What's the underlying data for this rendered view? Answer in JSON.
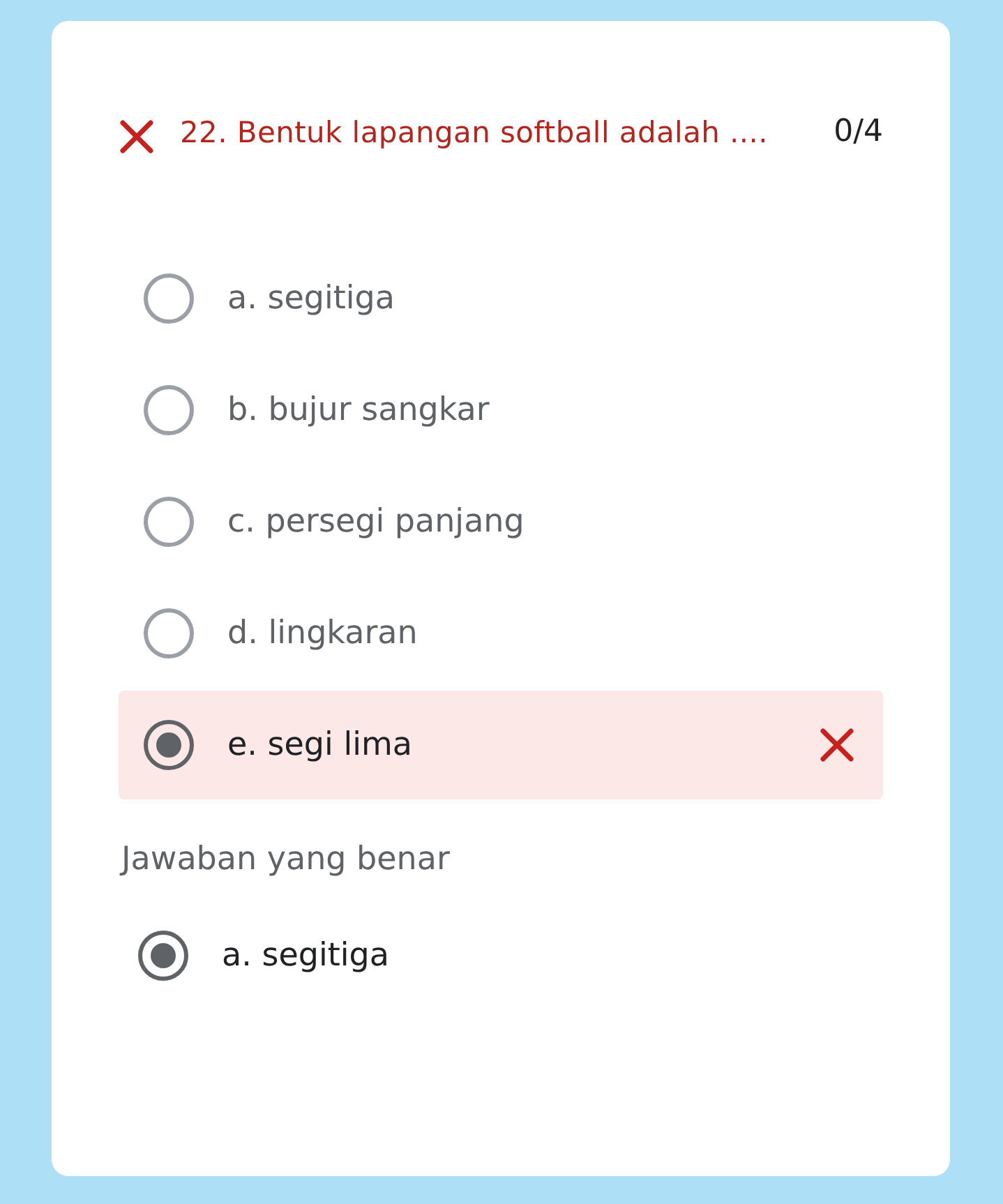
{
  "question": {
    "correct": false,
    "title": "22. Bentuk lapangan softball adalah ....",
    "score": "0/4"
  },
  "options": [
    {
      "label": "a. segitiga",
      "selected": false
    },
    {
      "label": "b. bujur sangkar",
      "selected": false
    },
    {
      "label": "c. persegi panjang",
      "selected": false
    },
    {
      "label": "d. lingkaran",
      "selected": false
    },
    {
      "label": "e. segi lima",
      "selected": true
    }
  ],
  "correct_answer": {
    "heading": "Jawaban yang benar",
    "options": [
      {
        "label": "a. segitiga",
        "selected": true
      }
    ]
  }
}
